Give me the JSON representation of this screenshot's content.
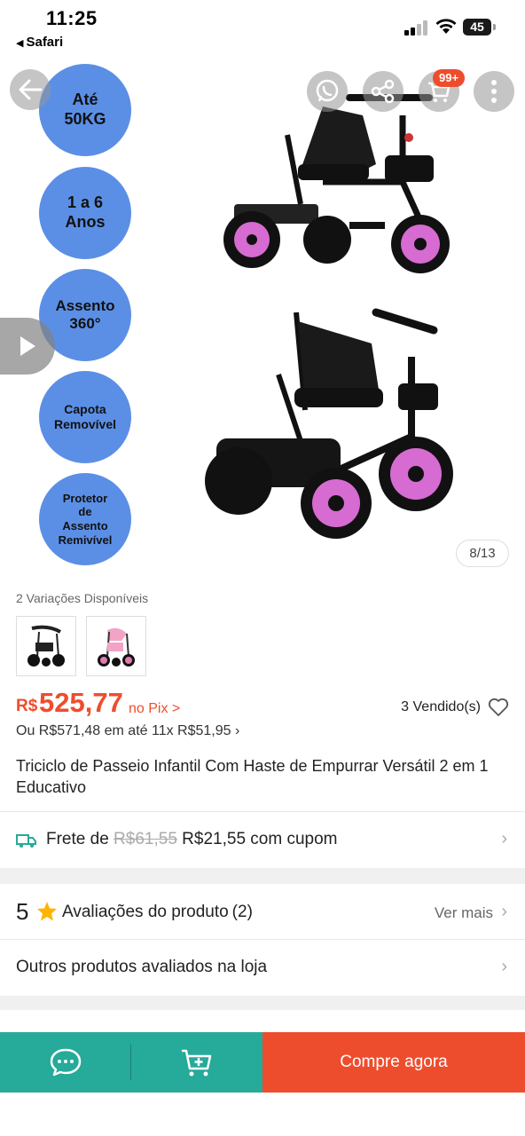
{
  "status_bar": {
    "time": "11:25",
    "back_app": "Safari",
    "battery": "45",
    "icons": [
      "signal-icon",
      "wifi-icon",
      "battery-icon"
    ]
  },
  "gallery": {
    "features": [
      "Até\n50KG",
      "1 a 6\nAnos",
      "Assento\n360°",
      "Capota\nRemovível",
      "Protetor\nde\nAssento\nRemivível"
    ],
    "counter": "8/13",
    "cart_badge": "99+",
    "icons": [
      "back-arrow-icon",
      "whatsapp-icon",
      "share-icon",
      "cart-icon",
      "more-icon",
      "play-icon"
    ],
    "wheel_color": "#d66bd1"
  },
  "variations": {
    "label": "2 Variações Disponíveis"
  },
  "price": {
    "currency": "R$",
    "value": "525,77",
    "pix": "no Pix >",
    "sold": "3 Vendido(s)",
    "installments": "Ou R$571,48 em até 11x R$51,95 ›"
  },
  "product": {
    "title": "Triciclo de Passeio Infantil Com Haste de Empurrar Versátil 2 em 1 Educativo"
  },
  "shipping": {
    "prefix": "Frete de",
    "old_price": "R$61,55",
    "new_price": "R$21,55 com cupom"
  },
  "ratings": {
    "score": "5",
    "label": "Avaliações do produto",
    "count": "(2)",
    "see_more": "Ver mais"
  },
  "others": {
    "label": "Outros produtos avaliados na loja"
  },
  "bottom_bar": {
    "buy_now": "Compre agora"
  },
  "colors": {
    "brand": "#ee4d2d",
    "chat_green": "#26aa99",
    "feature_blue": "#5b8fe6"
  }
}
